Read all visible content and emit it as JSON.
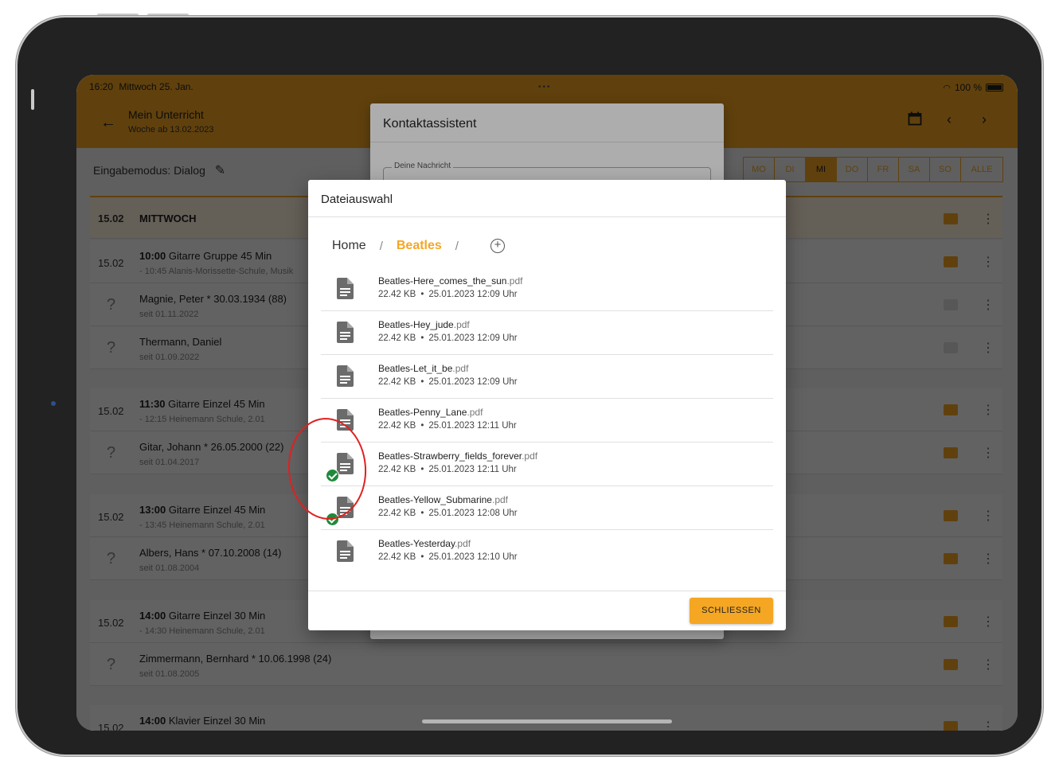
{
  "status": {
    "time": "16:20",
    "date": "Mittwoch 25. Jan.",
    "battery": "100 %"
  },
  "appbar": {
    "title": "Mein Unterricht",
    "subtitle": "Woche ab 13.02.2023"
  },
  "mode": {
    "label": "Eingabemodus: Dialog"
  },
  "day_tabs": [
    "MO",
    "DI",
    "MI",
    "DO",
    "FR",
    "SA",
    "SO",
    "ALLE"
  ],
  "schedule": {
    "day_header": {
      "date": "15.02",
      "day": "MITTWOCH"
    },
    "lessons": [
      {
        "date": "15.02",
        "time": "10:00",
        "title": "Gitarre Gruppe 45 Min",
        "sub": "- 10:45 Alanis-Morissette-Schule, Musik"
      },
      {
        "q": "?",
        "name": "Magnie, Peter * 30.03.1934 (88)",
        "since": "seit 01.11.2022"
      },
      {
        "q": "?",
        "name": "Thermann, Daniel",
        "since": "seit 01.09.2022"
      },
      {
        "date": "15.02",
        "time": "11:30",
        "title": "Gitarre Einzel 45 Min",
        "sub": "- 12:15 Heinemann Schule, 2.01"
      },
      {
        "q": "?",
        "name": "Gitar, Johann * 26.05.2000 (22)",
        "since": "seit 01.04.2017"
      },
      {
        "date": "15.02",
        "time": "13:00",
        "title": "Gitarre Einzel 45 Min",
        "sub": "- 13:45 Heinemann Schule, 2.01"
      },
      {
        "q": "?",
        "name": "Albers, Hans * 07.10.2008 (14)",
        "since": "seit 01.08.2004"
      },
      {
        "date": "15.02",
        "time": "14:00",
        "title": "Gitarre Einzel 30 Min",
        "sub": "- 14:30 Heinemann Schule, 2.01"
      },
      {
        "q": "?",
        "name": "Zimmermann, Bernhard * 10.06.1998 (24)",
        "since": "seit 01.08.2005"
      },
      {
        "date": "15.02",
        "time": "14:00",
        "title": "Klavier Einzel 30 Min",
        "sub": ""
      }
    ]
  },
  "contact_dialog": {
    "title": "Kontaktassistent",
    "message_label": "Deine Nachricht"
  },
  "file_dialog": {
    "title": "Dateiauswahl",
    "breadcrumb": {
      "home": "Home",
      "separator": "/",
      "current": "Beatles"
    },
    "files": [
      {
        "name": "Beatles-Here_comes_the_sun",
        "ext": ".pdf",
        "size": "22.42 KB",
        "date": "25.01.2023 12:09 Uhr",
        "selected": false
      },
      {
        "name": "Beatles-Hey_jude",
        "ext": ".pdf",
        "size": "22.42 KB",
        "date": "25.01.2023 12:09 Uhr",
        "selected": false
      },
      {
        "name": "Beatles-Let_it_be",
        "ext": ".pdf",
        "size": "22.42 KB",
        "date": "25.01.2023 12:09 Uhr",
        "selected": false
      },
      {
        "name": "Beatles-Penny_Lane",
        "ext": ".pdf",
        "size": "22.42 KB",
        "date": "25.01.2023 12:11 Uhr",
        "selected": false
      },
      {
        "name": "Beatles-Strawberry_fields_forever",
        "ext": ".pdf",
        "size": "22.42 KB",
        "date": "25.01.2023 12:11 Uhr",
        "selected": true
      },
      {
        "name": "Beatles-Yellow_Submarine",
        "ext": ".pdf",
        "size": "22.42 KB",
        "date": "25.01.2023 12:08 Uhr",
        "selected": true
      },
      {
        "name": "Beatles-Yesterday",
        "ext": ".pdf",
        "size": "22.42 KB",
        "date": "25.01.2023 12:10 Uhr",
        "selected": false
      }
    ],
    "meta_separator": "•",
    "close_label": "SCHLIESSEN"
  },
  "colors": {
    "accent": "#f5a623",
    "check": "#1f8a3a",
    "annotation": "#e02020"
  },
  "icons": {
    "back": "arrow-left-icon",
    "calendar": "calendar-icon",
    "prev": "chevron-left-icon",
    "next": "chevron-right-icon",
    "edit": "pencil-icon",
    "file": "document-icon",
    "add": "add-circle-icon",
    "selected": "check-circle-icon"
  }
}
